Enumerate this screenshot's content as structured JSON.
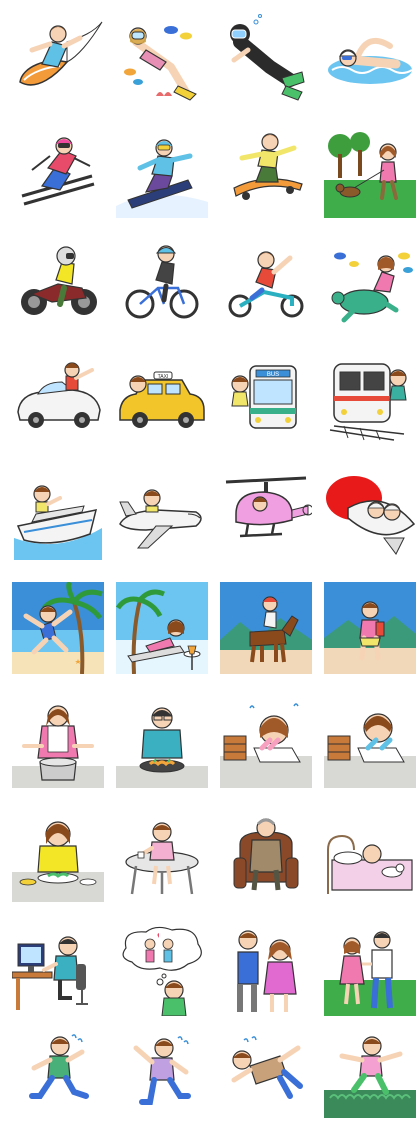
{
  "sheet": {
    "rows": [
      [
        "surfing",
        "scuba-diving",
        "wetsuit-diving",
        "swimming"
      ],
      [
        "skiing",
        "snowboarding",
        "skateboarding",
        "walking-dog"
      ],
      [
        "motorcycle",
        "bicycle",
        "tricycle",
        "swim-with-turtle"
      ],
      [
        "car",
        "taxi",
        "bus",
        "train"
      ],
      [
        "cruise-ship",
        "airplane",
        "helicopter",
        "rocket"
      ],
      [
        "beach-jump",
        "beach-lounging",
        "horse-riding",
        "hiking"
      ],
      [
        "cooking-pot",
        "cooking-pan",
        "studying-tired",
        "studying-writing"
      ],
      [
        "eating-meal",
        "cafe-table",
        "reading-chair",
        "sleeping-bed"
      ],
      [
        "computer-work",
        "daydreaming-couple",
        "couple-standing",
        "couple-walking"
      ],
      [
        "running",
        "running-tired",
        "falling",
        "jumping"
      ]
    ]
  },
  "labels": {
    "bus_sign": "BUS",
    "taxi_sign": "TAXI"
  },
  "colors": {
    "skin": "#f7d3b5",
    "hair_brown": "#8a4a1c",
    "sky_blue": "#3a8fd8",
    "sea_blue": "#6cc5f0",
    "grass_green": "#3fae4a",
    "gray_floor": "#d8d8d4",
    "outline": "#222222"
  }
}
